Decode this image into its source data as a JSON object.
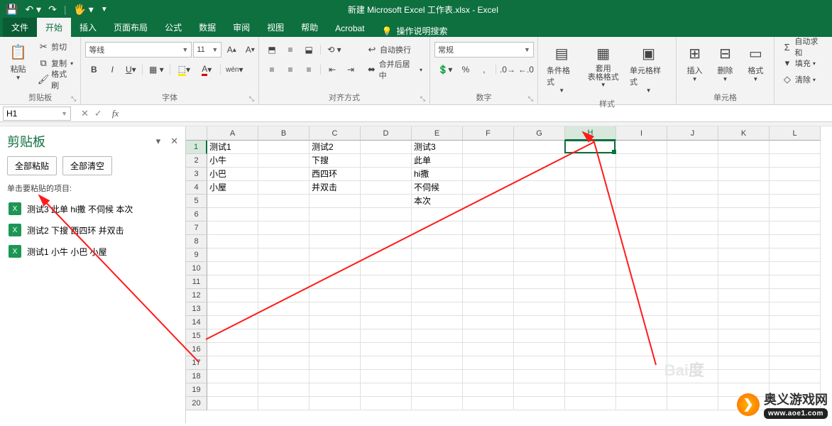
{
  "title": "新建 Microsoft Excel 工作表.xlsx  -  Excel",
  "tabs": {
    "file": "文件",
    "home": "开始",
    "insert": "插入",
    "layout": "页面布局",
    "formulas": "公式",
    "data": "数据",
    "review": "审阅",
    "view": "视图",
    "help": "帮助",
    "acrobat": "Acrobat",
    "tell": "操作说明搜索"
  },
  "ribbon": {
    "clipboard": {
      "paste": "粘贴",
      "cut": "剪切",
      "copy": "复制",
      "painter": "格式刷",
      "label": "剪贴板"
    },
    "font": {
      "name": "等线",
      "size": "11",
      "label": "字体"
    },
    "align": {
      "wrap": "自动换行",
      "merge": "合并后居中",
      "label": "对齐方式"
    },
    "number": {
      "format": "常规",
      "label": "数字"
    },
    "styles": {
      "cond": "条件格式",
      "table": "套用\n表格格式",
      "cell": "单元格样式",
      "label": "样式"
    },
    "cells": {
      "insert": "插入",
      "delete": "删除",
      "format": "格式",
      "label": "单元格"
    },
    "editing": {
      "sum": "自动求和",
      "fill": "填充",
      "clear": "清除"
    }
  },
  "namebox": "H1",
  "clipboardPane": {
    "title": "剪贴板",
    "pasteAll": "全部粘贴",
    "clearAll": "全部清空",
    "hint": "单击要粘贴的项目:",
    "items": [
      "测试3 此单 hi撒 不伺候 本次",
      "测试2 下搜 西四环 并双击",
      "测试1 小牛 小巴 小屋"
    ]
  },
  "columns": [
    "A",
    "B",
    "C",
    "D",
    "E",
    "F",
    "G",
    "H",
    "I",
    "J",
    "K",
    "L"
  ],
  "rowCount": 20,
  "gridData": {
    "1": {
      "A": "测试1",
      "C": "测试2",
      "E": "测试3"
    },
    "2": {
      "A": "小牛",
      "C": "下搜",
      "E": "此单"
    },
    "3": {
      "A": "小巴",
      "C": "西四环",
      "E": "hi撒"
    },
    "4": {
      "A": "小屋",
      "C": "并双击",
      "E": "不伺候"
    },
    "5": {
      "E": "本次"
    }
  },
  "activeCell": {
    "col": "H",
    "row": 1
  },
  "watermark": {
    "site": "奥义游戏网",
    "url": "www.aoe1.com"
  }
}
